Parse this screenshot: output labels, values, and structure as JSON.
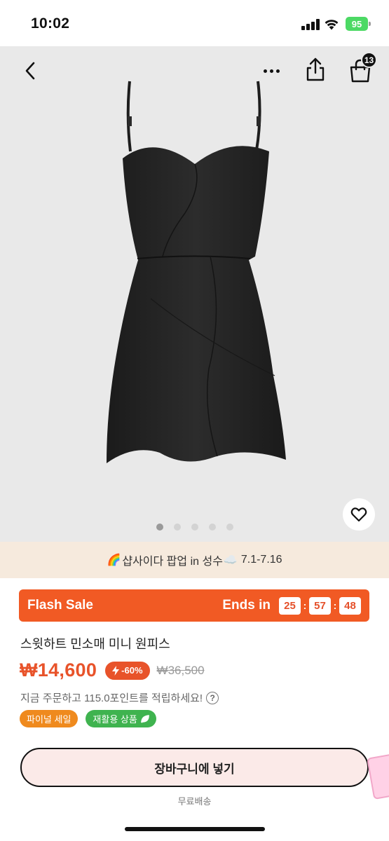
{
  "status_bar": {
    "time": "10:02",
    "battery": "95",
    "icons": [
      "signal-icon",
      "wifi-icon",
      "battery-icon"
    ]
  },
  "top_nav": {
    "icons": [
      "back-icon",
      "more-icon",
      "share-icon",
      "cart-icon"
    ],
    "cart_count": "13"
  },
  "gallery": {
    "image": "black sweetheart-neck mini dress",
    "page_count": 5,
    "active_index": 0,
    "wishlist_icon": "heart-icon"
  },
  "promo_banner": {
    "prefix_icon": "🌈",
    "text": "샵사이다 팝업 in 성수",
    "suffix_icon": "☁️",
    "dates": "7.1-7.16"
  },
  "flash_sale": {
    "title": "Flash Sale",
    "ends_label": "Ends in",
    "hours": "25",
    "minutes": "57",
    "seconds": "48",
    "color": "#f15a24"
  },
  "product": {
    "title": "스윗하트 민소매 미니 원피스",
    "price": "₩14,600",
    "discount": "-60%",
    "original_price": "₩36,500",
    "points_text": "지금 주문하고 115.0포인트를 적립하세요!",
    "tags": [
      {
        "label": "파이널 세일",
        "color": "#ef8a1e"
      },
      {
        "label": "재활용 상품",
        "color": "#3fb34f",
        "icon": "leaf-icon"
      }
    ]
  },
  "actions": {
    "add_to_cart": "장바구니에 넣기",
    "shipping": "무료배송"
  }
}
